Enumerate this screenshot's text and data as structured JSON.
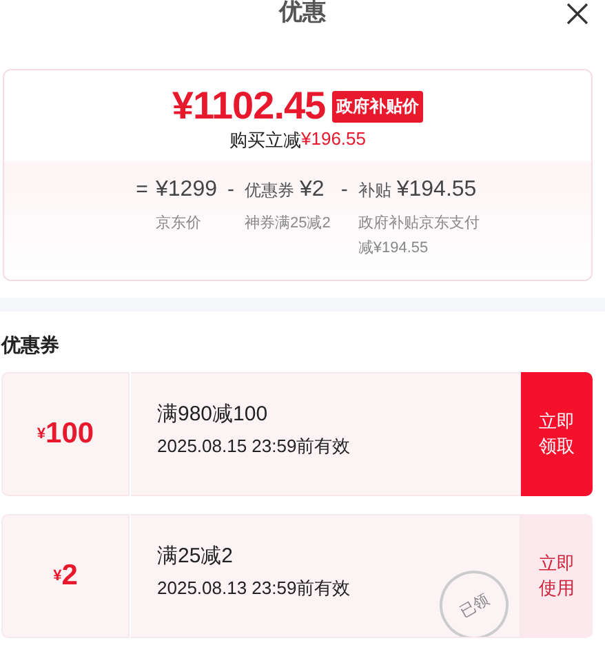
{
  "title": "优惠",
  "price": {
    "amount": "¥1102.45",
    "badge": "政府补贴价",
    "saving_label": "购买立减",
    "saving_amount": "¥196.55"
  },
  "breakdown": [
    {
      "operator": "=",
      "amount": "¥1299",
      "note": "京东价"
    },
    {
      "operator": "-",
      "label": "优惠券",
      "amount": "¥2",
      "note": "神券满25减2"
    },
    {
      "operator": "-",
      "label": "补贴",
      "amount": "¥194.55",
      "note": "政府补贴京东支付减¥194.55"
    }
  ],
  "coupons_heading": "优惠券",
  "coupons": [
    {
      "currency": "¥",
      "value": "100",
      "condition": "满980减100",
      "validity": "2025.08.15 23:59前有效",
      "action": "立即领取",
      "claimed": false
    },
    {
      "currency": "¥",
      "value": "2",
      "condition": "满25减2",
      "validity": "2025.08.13 23:59前有效",
      "action": "立即使用",
      "claimed": true,
      "stamp": "已领"
    }
  ]
}
